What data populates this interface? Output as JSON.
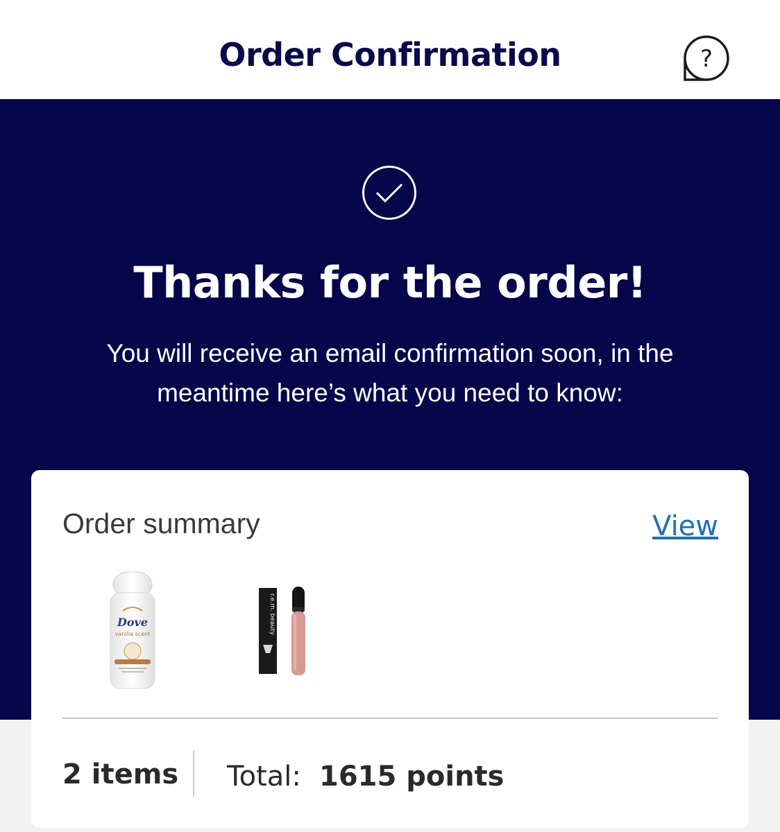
{
  "header": {
    "title": "Order Confirmation",
    "help_icon": "question-speech-bubble-icon"
  },
  "hero": {
    "check_icon": "check-circle-icon",
    "title": "Thanks for the order!",
    "subtitle": "You will receive an email confirmation soon, in the meantime here’s what you need to know:"
  },
  "order_summary": {
    "title": "Order summary",
    "view_label": "View",
    "products": [
      {
        "name": "Dove vanilla scent roll-on deodorant",
        "label": "Dove",
        "sublabel": "vanilla scent"
      },
      {
        "name": "r.e.m. beauty lip gloss",
        "label": "r.e.m. beauty"
      }
    ],
    "items_count": "2 items",
    "total_label": "Total:",
    "total_value": "1615 points"
  },
  "colors": {
    "navy": "#06064a",
    "header_text": "#0a0a4a",
    "link": "#1f6fb8",
    "page_bg": "#f2f2f2"
  }
}
